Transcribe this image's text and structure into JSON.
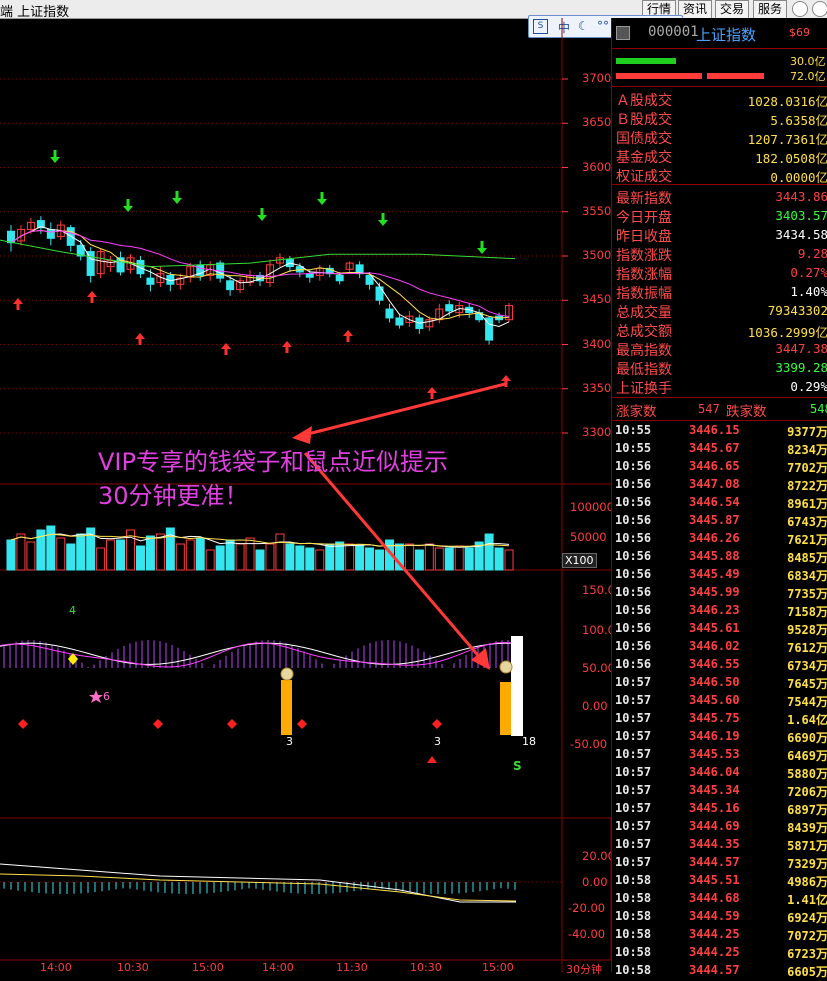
{
  "window": {
    "title": "端    上证指数",
    "menu": [
      "行情",
      "资讯",
      "交易",
      "服务"
    ]
  },
  "ime": {
    "items": [
      "中",
      "☾",
      "°°",
      "⌨",
      "▦",
      "⚔"
    ]
  },
  "panel": {
    "code": "000001",
    "name": "上证指数",
    "badge": "$69",
    "bar_top_value": "30.0亿",
    "bar_bottom_value": "72.0亿",
    "market": [
      {
        "k": "Ａ股成交",
        "v": "1028.0316亿",
        "c": "#ffe04b"
      },
      {
        "k": "Ｂ股成交",
        "v": "5.6358亿",
        "c": "#ffe04b"
      },
      {
        "k": "国债成交",
        "v": "1207.7361亿",
        "c": "#ffe04b"
      },
      {
        "k": "基金成交",
        "v": "182.0508亿",
        "c": "#ffe04b"
      },
      {
        "k": "权证成交",
        "v": "0.0000亿",
        "c": "#ffe04b"
      }
    ],
    "quote": [
      {
        "k": "最新指数",
        "v": "3443.86",
        "c": "#ff4040"
      },
      {
        "k": "今日开盘",
        "v": "3403.57",
        "c": "#35ff35"
      },
      {
        "k": "昨日收盘",
        "v": "3434.58",
        "c": "#ffffff"
      },
      {
        "k": "指数涨跌",
        "v": "9.28",
        "c": "#ff4040"
      },
      {
        "k": "指数涨幅",
        "v": "0.27%",
        "c": "#ff4040"
      },
      {
        "k": "指数振幅",
        "v": "1.40%",
        "c": "#ffffff"
      },
      {
        "k": "总成交量",
        "v": "79343302",
        "c": "#ffe04b"
      },
      {
        "k": "总成交额",
        "v": "1036.2999亿",
        "c": "#ffe04b"
      },
      {
        "k": "最高指数",
        "v": "3447.38",
        "c": "#ff4040"
      },
      {
        "k": "最低指数",
        "v": "3399.28",
        "c": "#35ff35"
      },
      {
        "k": "上证换手",
        "v": "0.29%",
        "c": "#ffffff"
      }
    ],
    "up_label": "涨家数",
    "up_value": "547",
    "down_label": "跌家数",
    "down_value": "548",
    "ticks": [
      {
        "t": "10:55",
        "p": "3446.15",
        "q": "9377万"
      },
      {
        "t": "10:55",
        "p": "3445.67",
        "q": "8234万"
      },
      {
        "t": "10:56",
        "p": "3446.65",
        "q": "7702万"
      },
      {
        "t": "10:56",
        "p": "3447.08",
        "q": "8722万"
      },
      {
        "t": "10:56",
        "p": "3446.54",
        "q": "8961万"
      },
      {
        "t": "10:56",
        "p": "3445.87",
        "q": "6743万"
      },
      {
        "t": "10:56",
        "p": "3446.26",
        "q": "7621万"
      },
      {
        "t": "10:56",
        "p": "3445.88",
        "q": "8485万"
      },
      {
        "t": "10:56",
        "p": "3445.49",
        "q": "6834万"
      },
      {
        "t": "10:56",
        "p": "3445.99",
        "q": "7735万"
      },
      {
        "t": "10:56",
        "p": "3446.23",
        "q": "7158万"
      },
      {
        "t": "10:56",
        "p": "3445.61",
        "q": "9528万"
      },
      {
        "t": "10:56",
        "p": "3446.02",
        "q": "7612万"
      },
      {
        "t": "10:56",
        "p": "3446.55",
        "q": "6734万"
      },
      {
        "t": "10:57",
        "p": "3446.50",
        "q": "7645万"
      },
      {
        "t": "10:57",
        "p": "3445.60",
        "q": "7544万"
      },
      {
        "t": "10:57",
        "p": "3445.75",
        "q": "1.64亿"
      },
      {
        "t": "10:57",
        "p": "3446.19",
        "q": "6690万"
      },
      {
        "t": "10:57",
        "p": "3445.53",
        "q": "6469万"
      },
      {
        "t": "10:57",
        "p": "3446.04",
        "q": "5880万"
      },
      {
        "t": "10:57",
        "p": "3445.34",
        "q": "7206万"
      },
      {
        "t": "10:57",
        "p": "3445.16",
        "q": "6897万"
      },
      {
        "t": "10:57",
        "p": "3444.69",
        "q": "8439万"
      },
      {
        "t": "10:57",
        "p": "3444.35",
        "q": "5871万"
      },
      {
        "t": "10:57",
        "p": "3444.57",
        "q": "7329万"
      },
      {
        "t": "10:58",
        "p": "3445.51",
        "q": "4986万"
      },
      {
        "t": "10:58",
        "p": "3444.68",
        "q": "1.41亿"
      },
      {
        "t": "10:58",
        "p": "3444.59",
        "q": "6924万"
      },
      {
        "t": "10:58",
        "p": "3444.25",
        "q": "7072万"
      },
      {
        "t": "10:58",
        "p": "3444.25",
        "q": "6723万"
      },
      {
        "t": "10:58",
        "p": "3444.57",
        "q": "6605万"
      }
    ]
  },
  "chart": {
    "price_axis": [
      "3700",
      "3650",
      "3600",
      "3550",
      "3500",
      "3450",
      "3400",
      "3350",
      "3300"
    ],
    "volume_axis": [
      "100000",
      "50000"
    ],
    "volume_unit": "X100",
    "indicator_axis": [
      "150.0",
      "100.0",
      "50.00",
      "0.00",
      "-50.00"
    ],
    "macd_axis": [
      "20.00",
      "0.00",
      "-20.00",
      "-40.00"
    ],
    "annotation_line1": "VIP专享的钱袋子和鼠点近似提示",
    "annotation_line2": "30分钟更准！",
    "indicator_labels": {
      "four": "4",
      "six": "6",
      "three_a": "3",
      "three_b": "3",
      "eighteen": "18",
      "s": "S",
      "zeros": [
        "0",
        "0",
        "0",
        "0",
        "0",
        "0"
      ]
    },
    "time_axis": [
      "14:00",
      "10:30",
      "15:00",
      "14:00",
      "11:30",
      "10:30",
      "15:00",
      "30分钟"
    ]
  },
  "chart_data": {
    "type": "candlestick",
    "ylim": [
      3280,
      3720
    ],
    "candles": [
      {
        "o": 3528,
        "c": 3515,
        "h": 3535,
        "l": 3505
      },
      {
        "o": 3517,
        "c": 3530,
        "h": 3535,
        "l": 3512
      },
      {
        "o": 3530,
        "c": 3538,
        "h": 3543,
        "l": 3525
      },
      {
        "o": 3540,
        "c": 3532,
        "h": 3545,
        "l": 3525
      },
      {
        "o": 3530,
        "c": 3520,
        "h": 3538,
        "l": 3512
      },
      {
        "o": 3522,
        "c": 3535,
        "h": 3540,
        "l": 3518
      },
      {
        "o": 3532,
        "c": 3512,
        "h": 3535,
        "l": 3505
      },
      {
        "o": 3512,
        "c": 3500,
        "h": 3518,
        "l": 3495
      },
      {
        "o": 3505,
        "c": 3478,
        "h": 3510,
        "l": 3470
      },
      {
        "o": 3480,
        "c": 3505,
        "h": 3508,
        "l": 3475
      },
      {
        "o": 3488,
        "c": 3495,
        "h": 3500,
        "l": 3482
      },
      {
        "o": 3498,
        "c": 3482,
        "h": 3505,
        "l": 3478
      },
      {
        "o": 3485,
        "c": 3498,
        "h": 3502,
        "l": 3480
      },
      {
        "o": 3495,
        "c": 3480,
        "h": 3500,
        "l": 3475
      },
      {
        "o": 3475,
        "c": 3468,
        "h": 3485,
        "l": 3460
      },
      {
        "o": 3470,
        "c": 3480,
        "h": 3488,
        "l": 3465
      },
      {
        "o": 3478,
        "c": 3468,
        "h": 3482,
        "l": 3460
      },
      {
        "o": 3468,
        "c": 3475,
        "h": 3480,
        "l": 3462
      },
      {
        "o": 3476,
        "c": 3488,
        "h": 3492,
        "l": 3470
      },
      {
        "o": 3490,
        "c": 3478,
        "h": 3495,
        "l": 3472
      },
      {
        "o": 3478,
        "c": 3490,
        "h": 3494,
        "l": 3472
      },
      {
        "o": 3492,
        "c": 3475,
        "h": 3495,
        "l": 3470
      },
      {
        "o": 3472,
        "c": 3462,
        "h": 3478,
        "l": 3455
      },
      {
        "o": 3462,
        "c": 3472,
        "h": 3476,
        "l": 3458
      },
      {
        "o": 3470,
        "c": 3478,
        "h": 3484,
        "l": 3466
      },
      {
        "o": 3478,
        "c": 3472,
        "h": 3482,
        "l": 3466
      },
      {
        "o": 3470,
        "c": 3490,
        "h": 3496,
        "l": 3465
      },
      {
        "o": 3492,
        "c": 3498,
        "h": 3503,
        "l": 3488
      },
      {
        "o": 3496,
        "c": 3488,
        "h": 3500,
        "l": 3482
      },
      {
        "o": 3488,
        "c": 3482,
        "h": 3492,
        "l": 3476
      },
      {
        "o": 3480,
        "c": 3476,
        "h": 3485,
        "l": 3470
      },
      {
        "o": 3478,
        "c": 3486,
        "h": 3490,
        "l": 3472
      },
      {
        "o": 3486,
        "c": 3480,
        "h": 3490,
        "l": 3476
      },
      {
        "o": 3478,
        "c": 3472,
        "h": 3482,
        "l": 3468
      },
      {
        "o": 3485,
        "c": 3492,
        "h": 3494,
        "l": 3480
      },
      {
        "o": 3490,
        "c": 3480,
        "h": 3494,
        "l": 3475
      },
      {
        "o": 3478,
        "c": 3468,
        "h": 3482,
        "l": 3462
      },
      {
        "o": 3465,
        "c": 3450,
        "h": 3470,
        "l": 3445
      },
      {
        "o": 3440,
        "c": 3430,
        "h": 3446,
        "l": 3425
      },
      {
        "o": 3430,
        "c": 3422,
        "h": 3435,
        "l": 3418
      },
      {
        "o": 3425,
        "c": 3432,
        "h": 3438,
        "l": 3420
      },
      {
        "o": 3430,
        "c": 3418,
        "h": 3434,
        "l": 3412
      },
      {
        "o": 3420,
        "c": 3428,
        "h": 3432,
        "l": 3415
      },
      {
        "o": 3428,
        "c": 3440,
        "h": 3446,
        "l": 3424
      },
      {
        "o": 3445,
        "c": 3438,
        "h": 3450,
        "l": 3432
      },
      {
        "o": 3436,
        "c": 3444,
        "h": 3448,
        "l": 3430
      },
      {
        "o": 3442,
        "c": 3436,
        "h": 3446,
        "l": 3430
      },
      {
        "o": 3436,
        "c": 3428,
        "h": 3440,
        "l": 3425
      },
      {
        "o": 3430,
        "c": 3405,
        "h": 3432,
        "l": 3400
      },
      {
        "o": 3432,
        "c": 3428,
        "h": 3436,
        "l": 3424
      },
      {
        "o": 3428,
        "c": 3444,
        "h": 3447,
        "l": 3425
      }
    ]
  },
  "colors": {
    "up": "#ff3c3c",
    "down": "#35e6ee",
    "ma_white": "#ffffff",
    "ma_yellow": "#ffe04b",
    "ma_magenta": "#ff40ff",
    "ma_green": "#35dd35"
  }
}
